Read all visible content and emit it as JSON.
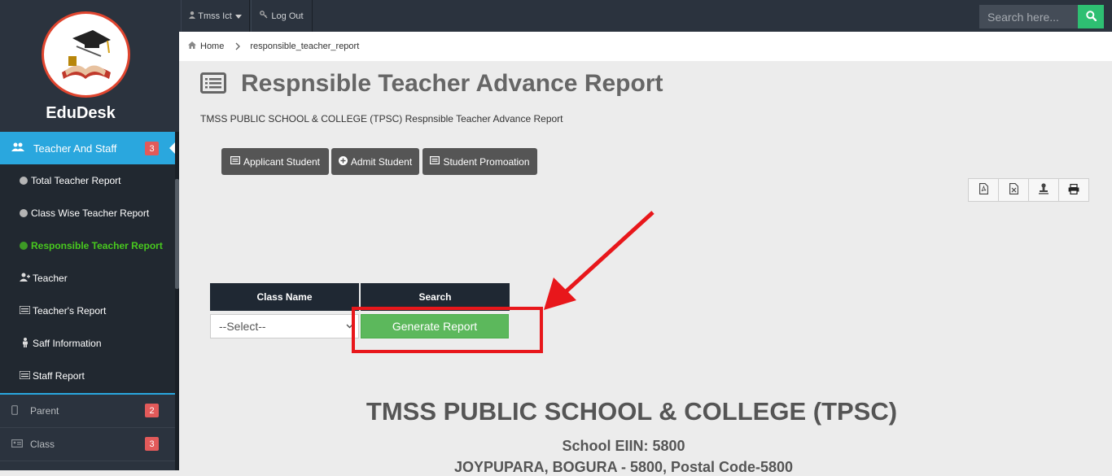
{
  "app": {
    "brand": "EduDesk"
  },
  "topbar": {
    "user_label": "Tmss Ict",
    "logout_label": "Log Out",
    "search_placeholder": "Search here..."
  },
  "breadcrumb": {
    "home": "Home",
    "current": "responsible_teacher_report"
  },
  "page": {
    "title": "Respnsible Teacher Advance Report",
    "subtitle": "TMSS PUBLIC SCHOOL & COLLEGE (TPSC) Respnsible Teacher Advance Report"
  },
  "sidebar": {
    "active_section": {
      "label": "Teacher And Staff",
      "badge": "3"
    },
    "submenu": [
      {
        "label": "Total Teacher Report"
      },
      {
        "label": "Class Wise Teacher Report"
      },
      {
        "label": "Responsible Teacher Report"
      },
      {
        "label": "Teacher"
      },
      {
        "label": "Teacher's Report"
      },
      {
        "label": "Saff Information"
      },
      {
        "label": "Staff Report"
      }
    ],
    "sections": [
      {
        "label": "Parent",
        "badge": "2"
      },
      {
        "label": "Class",
        "badge": "3"
      }
    ]
  },
  "actions": {
    "applicant_student": "Applicant Student",
    "admit_student": "Admit Student",
    "student_promotion": "Student Promoation"
  },
  "form": {
    "col_class": "Class Name",
    "col_search": "Search",
    "select_value": "--Select--",
    "generate_label": "Generate Report"
  },
  "school": {
    "name": "TMSS PUBLIC SCHOOL & COLLEGE (TPSC)",
    "eiin": "School EIIN: 5800",
    "address": "JOYPUPARA, BOGURA - 5800, Postal Code-5800"
  },
  "colors": {
    "sidebar_bg": "#2b333e",
    "active_blue": "#2aa7de",
    "active_green": "#48c91e",
    "generate_green": "#5cb85c",
    "highlight_red": "#e8171b",
    "badge_red": "#e25a5a"
  }
}
